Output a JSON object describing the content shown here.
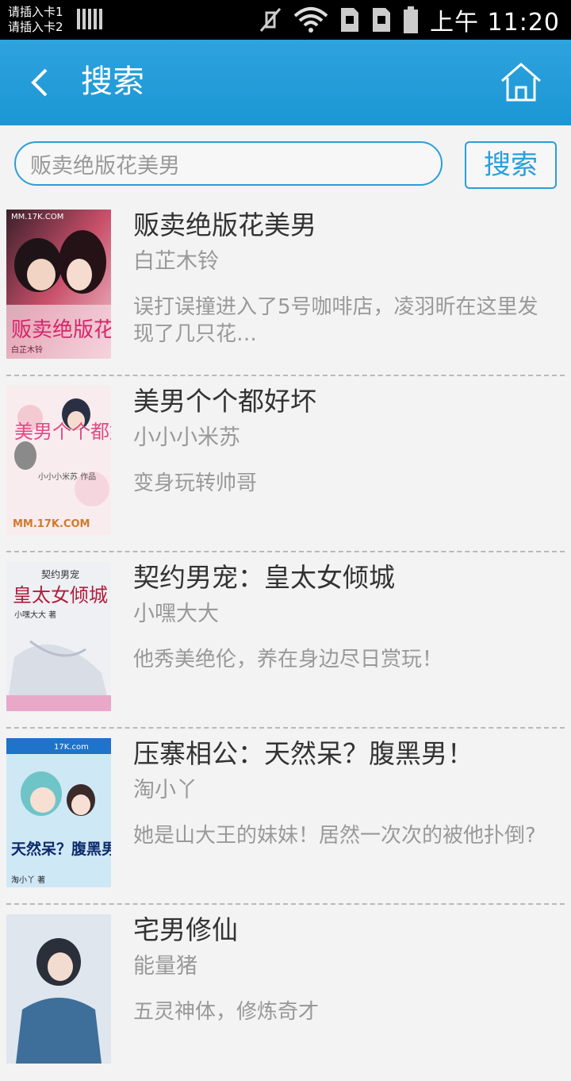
{
  "status_bar": {
    "sim1": "请插入卡1",
    "sim2": "请插入卡2",
    "time": "上午 11:20",
    "icons": [
      "signal-bars-icon",
      "mute-icon",
      "wifi-icon",
      "sim-card-icon",
      "sim-card-icon",
      "battery-icon"
    ]
  },
  "header": {
    "back_icon": "back-arrow-icon",
    "title": "搜索",
    "home_icon": "home-icon"
  },
  "search": {
    "value": "贩卖绝版花美男",
    "button_label": "搜索"
  },
  "results": [
    {
      "title": "贩卖绝版花美男",
      "author": "白芷木铃",
      "desc": "误打误撞进入了5号咖啡店，凌羽昕在这里发现了几只花…",
      "cover_text": "MM.17K.COM",
      "cover_title": "贩卖绝版花美男",
      "cover_author": "白芷木铃"
    },
    {
      "title": "美男个个都好坏",
      "author": "小小小米苏",
      "desc": "变身玩转帅哥",
      "cover_text": "MM.17K.COM",
      "cover_title": "美男个个都好坏",
      "cover_author": "小小小米苏 作品"
    },
    {
      "title": "契约男宠：皇太女倾城",
      "author": "小嘿大大",
      "desc": "他秀美绝伦，养在身边尽日赏玩！",
      "cover_text": "契约男宠",
      "cover_title": "皇太女倾城",
      "cover_author": "小嘿大大 著"
    },
    {
      "title": "压寨相公：天然呆？腹黑男！",
      "author": "淘小丫",
      "desc": "她是山大王的妹妹！居然一次次的被他扑倒?",
      "cover_text": "17K.com",
      "cover_title": "天然呆？腹黑男！",
      "cover_author": "淘小丫 著"
    },
    {
      "title": "宅男修仙",
      "author": "能量猪",
      "desc": "五灵神体，修炼奇才",
      "cover_text": "",
      "cover_title": "",
      "cover_author": ""
    }
  ]
}
